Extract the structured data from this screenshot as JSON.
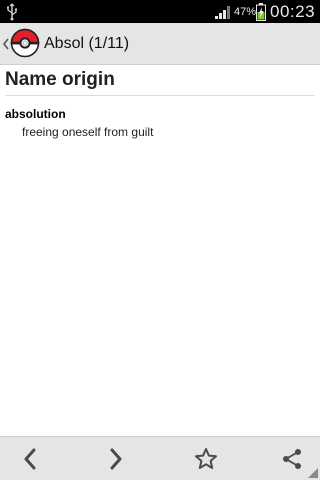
{
  "status_bar": {
    "battery_percent": "47%",
    "time": "00:23",
    "icons": [
      "usb-icon",
      "signal-icon",
      "battery-charging-icon"
    ]
  },
  "action_bar": {
    "title": "Absol (1/11)",
    "icons": [
      "up-chevron-icon",
      "pokeball-icon"
    ]
  },
  "content": {
    "heading": "Name origin",
    "entries": [
      {
        "term": "absolution",
        "definition": "freeing oneself from guilt"
      }
    ]
  },
  "bottom_bar": {
    "icons": [
      "previous-icon",
      "next-icon",
      "favorite-star-icon",
      "share-icon"
    ]
  },
  "colors": {
    "status_bar_bg": "#000000",
    "action_bar_bg": "#e5e5e5",
    "bottom_bar_bg": "#e5e5e5",
    "icon_gray": "#4a4a4a",
    "battery_green": "#7cc52c",
    "pokeball_red": "#e3202a"
  }
}
